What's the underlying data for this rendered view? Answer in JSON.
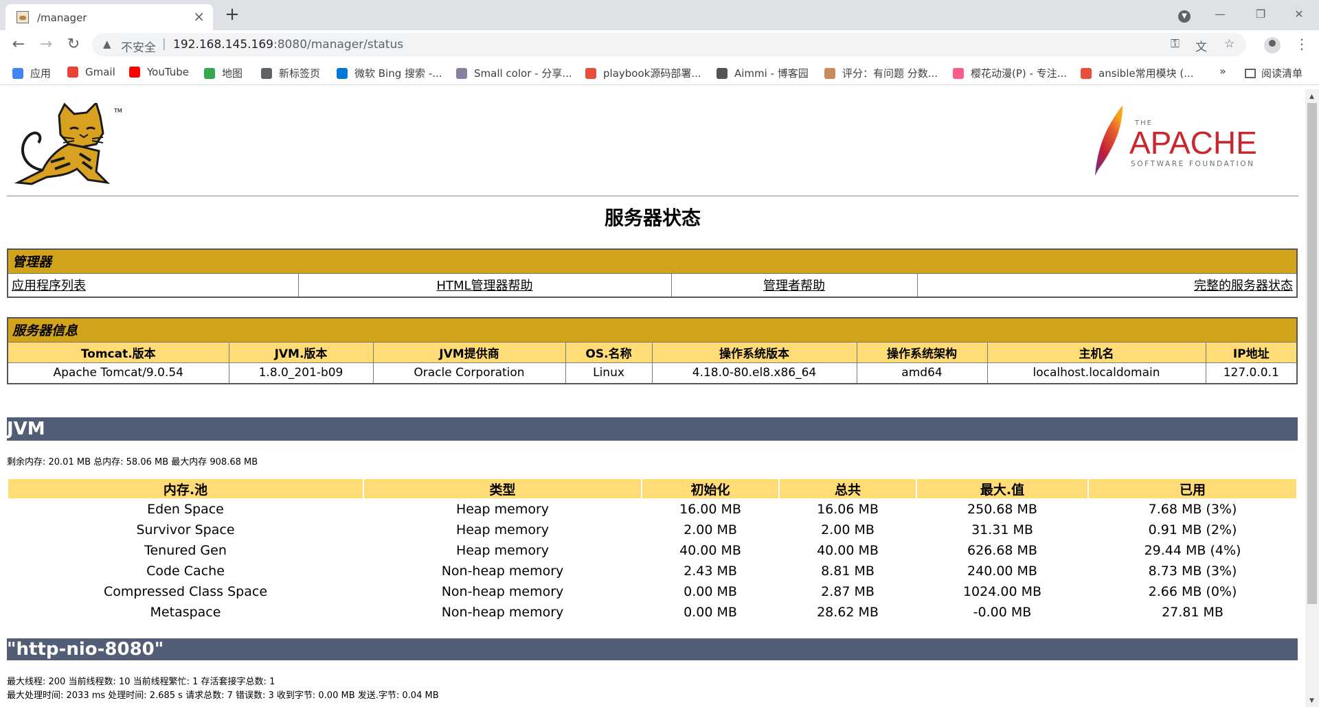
{
  "browser": {
    "tab_title": "/manager",
    "tab_close": "×",
    "new_tab": "+",
    "security_label": "不安全",
    "url_host": "192.168.145.169",
    "url_rest": ":8080/manager/status",
    "bookmarks": [
      {
        "label": "应用",
        "icon": "apps-icon",
        "color": "#4285f4"
      },
      {
        "label": "Gmail",
        "icon": "gmail-icon",
        "color": "#ea4335"
      },
      {
        "label": "YouTube",
        "icon": "youtube-icon",
        "color": "#ff0000"
      },
      {
        "label": "地图",
        "icon": "maps-icon",
        "color": "#34a853"
      },
      {
        "label": "新标签页",
        "icon": "globe-icon",
        "color": "#5f6368"
      },
      {
        "label": "微软 Bing 搜索 -...",
        "icon": "bing-icon",
        "color": "#0078d4"
      },
      {
        "label": "Small color - 分享...",
        "icon": "smallcolor-icon",
        "color": "#8a7f9e"
      },
      {
        "label": "playbook源码部署...",
        "icon": "csdn-icon",
        "color": "#e94e3c"
      },
      {
        "label": "Aimmi - 博客园",
        "icon": "cnblogs-icon",
        "color": "#555555"
      },
      {
        "label": "评分：有问题 分数...",
        "icon": "avatar-icon",
        "color": "#c98b5a"
      },
      {
        "label": "樱花动漫(P) - 专注...",
        "icon": "sakura-icon",
        "color": "#ff5b8a"
      },
      {
        "label": "ansible常用模块 (...",
        "icon": "csdn-icon",
        "color": "#e94e3c"
      }
    ],
    "bookmarks_overflow": "»",
    "reading_list": "阅读清单"
  },
  "page": {
    "title": "服务器状态",
    "apache_the": "THE",
    "apache_name": "APACHE",
    "apache_sub": "SOFTWARE FOUNDATION",
    "tomcat_tm": "TM"
  },
  "manager": {
    "header": "管理器",
    "links": [
      "应用程序列表",
      "HTML管理器帮助",
      "管理者帮助",
      "完整的服务器状态"
    ]
  },
  "server_info": {
    "header": "服务器信息",
    "columns": [
      "Tomcat.版本",
      "JVM.版本",
      "JVM提供商",
      "OS.名称",
      "操作系统版本",
      "操作系统架构",
      "主机名",
      "IP地址"
    ],
    "values": [
      "Apache Tomcat/9.0.54",
      "1.8.0_201-b09",
      "Oracle Corporation",
      "Linux",
      "4.18.0-80.el8.x86_64",
      "amd64",
      "localhost.localdomain",
      "127.0.0.1"
    ]
  },
  "jvm": {
    "header": "JVM",
    "memory_line": "剩余内存:   20.01 MB 总内存:   58.06 MB 最大内存 908.68 MB",
    "pool_columns": [
      "内存.池",
      "类型",
      "初始化",
      "总共",
      "最大.值",
      "已用"
    ],
    "pools": [
      [
        "Eden Space",
        "Heap memory",
        "16.00 MB",
        "16.06 MB",
        "250.68 MB",
        "7.68 MB (3%)"
      ],
      [
        "Survivor Space",
        "Heap memory",
        "2.00 MB",
        "2.00 MB",
        "31.31 MB",
        "0.91 MB (2%)"
      ],
      [
        "Tenured Gen",
        "Heap memory",
        "40.00 MB",
        "40.00 MB",
        "626.68 MB",
        "29.44 MB (4%)"
      ],
      [
        "Code Cache",
        "Non-heap memory",
        "2.43 MB",
        "8.81 MB",
        "240.00 MB",
        "8.73 MB (3%)"
      ],
      [
        "Compressed Class Space",
        "Non-heap memory",
        "0.00 MB",
        "2.87 MB",
        "1024.00 MB",
        "2.66 MB (0%)"
      ],
      [
        "Metaspace",
        "Non-heap memory",
        "0.00 MB",
        "28.62 MB",
        "-0.00 MB",
        "27.81 MB"
      ]
    ]
  },
  "connector": {
    "header": "\"http-nio-8080\"",
    "line1": "最大线程:   200 当前线程数:   10 当前线程繁忙:   1 存活套接字总数:   1",
    "line2": "最大处理时间:   2033 ms 处理时间:   2.685 s 请求总数:   7 错误数:   3 收到字节:   0.00 MB 发送.字节: 0.04 MB"
  },
  "colors": {
    "section_gold": "#d2a41c",
    "header_light_gold": "#ffdc75",
    "jvm_bar": "#525d76"
  }
}
